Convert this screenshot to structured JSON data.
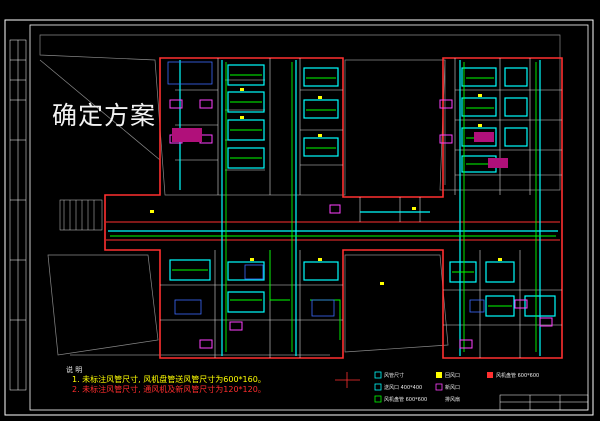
{
  "drawing": {
    "stamp_text": "确定方案",
    "notes_title": "说 明",
    "note1": "1. 未标注风管尺寸, 风机盘管送风管尺寸为600*160。",
    "note2": "2. 未标注风管尺寸, 通风机及新风管尺寸为120*120。",
    "legend": {
      "item1": "风管尺寸",
      "item2": "送风口 400*400",
      "item3": "回风口",
      "item4": "新风口",
      "item5": "风机盘管 600*600",
      "item6": "排风扇",
      "item7": "风机盘管 600*600"
    }
  },
  "colors": {
    "background": "#000000",
    "frame": "#ffffff",
    "walls": "#ff3030",
    "ducts": "#00ffff",
    "pipes": "#00ff00",
    "equipment": "#ff00ff",
    "labels": "#ffff00"
  }
}
